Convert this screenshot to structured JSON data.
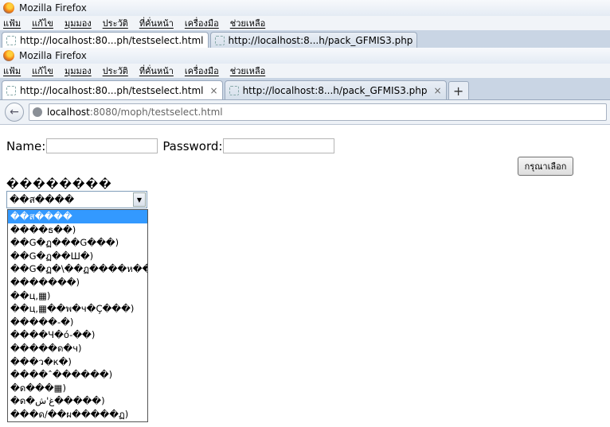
{
  "window": {
    "title": "Mozilla Firefox"
  },
  "menu": [
    "แฟ้ม",
    "แก้ไข",
    "มุมมอง",
    "ประวัติ",
    "ที่คั่นหน้า",
    "เครื่องมือ",
    "ช่วยเหลือ"
  ],
  "tabs": [
    {
      "label": "http://localhost:80...ph/testselect.html"
    },
    {
      "label": "http://localhost:8...h/pack_GFMIS3.php"
    }
  ],
  "tabs_behind": [
    {
      "label": "http://localhost:80...ph/testselect.html"
    },
    {
      "label": "http://localhost:8...h/pack_GFMIS3.php"
    }
  ],
  "new_tab": "+",
  "tab_close": "×",
  "url": {
    "host": "localhost",
    "rest": ":8080/moph/testselect.html"
  },
  "form": {
    "name_label": "Name:",
    "password_label": "Password:",
    "name_value": "",
    "password_value": "",
    "submit_label": "กรุณาเลือก",
    "select_label": "��������",
    "select_value": "��ส����"
  },
  "options": [
    "��ส����",
    "����ธ��)",
    "��G�ฏ���G���)",
    "��G�ฏ��Ш�)",
    "��G�ฏ�\\��ฏ����ห��)",
    "�������)",
    "��ц,▦)",
    "��ц,▦��พ�ч�Ç���)",
    "�����-�)",
    "����Ч�ó-��)",
    "�����ด�ч)",
    "���ว�к�)",
    "����ˆ������)",
    "�ด���▦)",
    "�ด�غ'ش�����)",
    "���ด/��ผ�����ฏ)"
  ],
  "selected_index": 0
}
